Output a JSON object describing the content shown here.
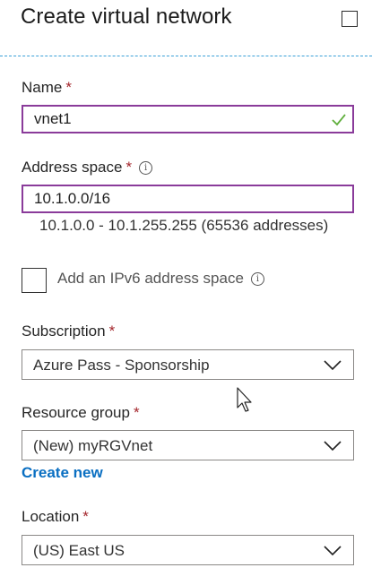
{
  "header": {
    "title": "Create virtual network"
  },
  "form": {
    "name": {
      "label": "Name",
      "required": "*",
      "value": "vnet1"
    },
    "address_space": {
      "label": "Address space",
      "required": "*",
      "value": "10.1.0.0/16",
      "hint": "10.1.0.0 - 10.1.255.255 (65536 addresses)"
    },
    "ipv6": {
      "label": "Add an IPv6 address space",
      "checked": false
    },
    "subscription": {
      "label": "Subscription",
      "required": "*",
      "value": "Azure Pass - Sponsorship"
    },
    "resource_group": {
      "label": "Resource group",
      "required": "*",
      "value": "(New) myRGVnet",
      "create_new": "Create new"
    },
    "location": {
      "label": "Location",
      "required": "*",
      "value": "(US) East US"
    }
  },
  "icons": {
    "maximize": "maximize-icon",
    "info": "info-icon",
    "valid": "checkmark-icon",
    "chevron": "chevron-down-icon",
    "cursor": "mouse-cursor-icon"
  },
  "colors": {
    "accent_border": "#8a3b9a",
    "required": "#a4262c",
    "link": "#0a6fc2",
    "valid": "#5fae3c",
    "divider": "#3aa0d8"
  }
}
